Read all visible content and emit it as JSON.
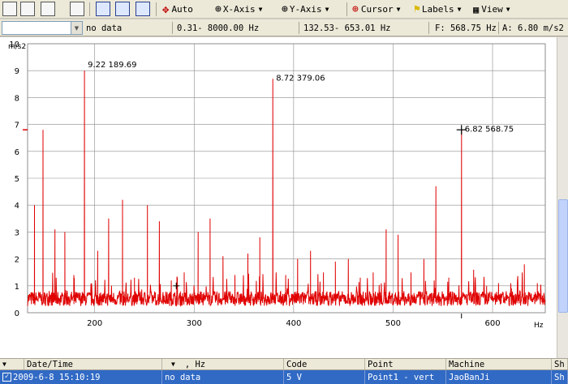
{
  "toolbar": {
    "auto_label": "Auto",
    "xaxis_label": "X-Axis",
    "yaxis_label": "Y-Axis",
    "cursor_label": "Cursor",
    "labels_label": "Labels",
    "view_label": "View"
  },
  "status": {
    "combo_value": "",
    "channel": "no data",
    "range": "0.31- 8000.00 Hz",
    "band": "132.53- 653.01 Hz",
    "freq": "F: 568.75 Hz",
    "amp": "A: 6.80 m/s2"
  },
  "table": {
    "headers": [
      "Date/Time",
      ", Hz",
      "Code",
      "Point",
      "Machine",
      "Sh"
    ],
    "row": {
      "datetime": "2009-6-8 15:10:19",
      "hz": "no data",
      "code": "5 V",
      "point": "Point1 - vert",
      "machine": "JaoBanJi",
      "sh": "Sh"
    }
  },
  "colors": {
    "series": "#e00000",
    "grid": "#8c8c8c",
    "selection": "#316ac5"
  },
  "chart_data": {
    "type": "line",
    "xlabel": "Hz",
    "ylabel": "m/s2",
    "xlim": [
      132.53,
      653.01
    ],
    "ylim": [
      0,
      10
    ],
    "x_ticks": [
      200,
      300,
      400,
      500,
      600
    ],
    "y_ticks": [
      0,
      1,
      2,
      3,
      4,
      5,
      6,
      7,
      8,
      9,
      10
    ],
    "grid": true,
    "annotations": [
      {
        "x": 189.69,
        "y": 9.22,
        "text": "9.22   189.69"
      },
      {
        "x": 379.06,
        "y": 8.72,
        "text": "8.72   379.06"
      },
      {
        "x": 568.75,
        "y": 6.82,
        "text": "6.82   568.75"
      }
    ],
    "cursor": {
      "x": 568.75,
      "y": 6.8
    },
    "series": [
      {
        "peaks": [
          [
            139.5,
            4.0
          ],
          [
            148.0,
            6.8
          ],
          [
            160.0,
            3.1
          ],
          [
            170.0,
            3.0
          ],
          [
            179.0,
            1.4
          ],
          [
            189.7,
            9.0
          ],
          [
            203.0,
            2.3
          ],
          [
            214.0,
            3.5
          ],
          [
            228.0,
            4.2
          ],
          [
            240.0,
            1.3
          ],
          [
            253.0,
            4.0
          ],
          [
            265.0,
            3.4
          ],
          [
            277.0,
            1.2
          ],
          [
            290.0,
            1.5
          ],
          [
            304.0,
            3.0
          ],
          [
            316.0,
            3.5
          ],
          [
            329.0,
            2.1
          ],
          [
            341.0,
            1.4
          ],
          [
            354.0,
            2.2
          ],
          [
            366.0,
            2.8
          ],
          [
            379.1,
            8.7
          ],
          [
            392.0,
            1.4
          ],
          [
            404.0,
            2.0
          ],
          [
            417.0,
            2.3
          ],
          [
            430.0,
            1.5
          ],
          [
            442.0,
            1.9
          ],
          [
            455.0,
            2.0
          ],
          [
            467.0,
            1.3
          ],
          [
            480.0,
            1.5
          ],
          [
            493.0,
            3.1
          ],
          [
            505.0,
            2.9
          ],
          [
            518.0,
            1.5
          ],
          [
            531.0,
            2.0
          ],
          [
            543.0,
            4.7
          ],
          [
            556.0,
            1.3
          ],
          [
            568.8,
            6.8
          ],
          [
            581.0,
            1.6
          ],
          [
            594.0,
            1.0
          ],
          [
            606.0,
            1.1
          ],
          [
            619.0,
            0.9
          ],
          [
            632.0,
            1.8
          ],
          [
            645.0,
            1.1
          ]
        ]
      }
    ]
  }
}
